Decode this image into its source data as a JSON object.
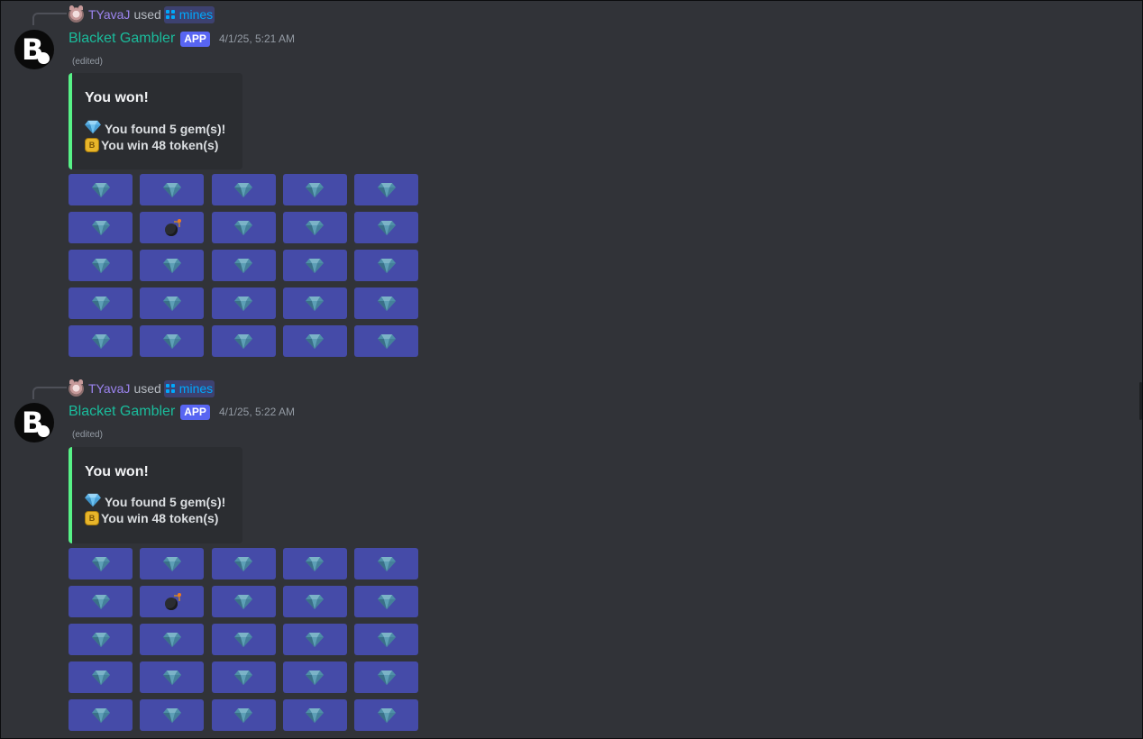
{
  "messages": [
    {
      "reply": {
        "user": "TYavaJ",
        "used": "used",
        "command": "mines"
      },
      "author": "Blacket Gambler",
      "badge": "APP",
      "timestamp": "4/1/25, 5:21 AM",
      "edited": "(edited)",
      "embed": {
        "title": "You won!",
        "line1": "You found 5 gem(s)!",
        "line2": "You win 48 token(s)",
        "accent": "#57f287"
      },
      "grid": [
        [
          "gem",
          "gem",
          "gem",
          "gem",
          "gem"
        ],
        [
          "gem",
          "bomb",
          "gem",
          "gem",
          "gem"
        ],
        [
          "gem",
          "gem",
          "gem",
          "gem",
          "gem"
        ],
        [
          "gem",
          "gem",
          "gem",
          "gem",
          "gem"
        ],
        [
          "gem",
          "gem",
          "gem",
          "gem",
          "gem"
        ]
      ]
    },
    {
      "reply": {
        "user": "TYavaJ",
        "used": "used",
        "command": "mines"
      },
      "author": "Blacket Gambler",
      "badge": "APP",
      "timestamp": "4/1/25, 5:22 AM",
      "edited": "(edited)",
      "embed": {
        "title": "You won!",
        "line1": "You found 5 gem(s)!",
        "line2": "You win 48 token(s)",
        "accent": "#57f287"
      },
      "grid": [
        [
          "gem",
          "gem",
          "gem",
          "gem",
          "gem"
        ],
        [
          "gem",
          "bomb",
          "gem",
          "gem",
          "gem"
        ],
        [
          "gem",
          "gem",
          "gem",
          "gem",
          "gem"
        ],
        [
          "gem",
          "gem",
          "gem",
          "gem",
          "gem"
        ],
        [
          "gem",
          "gem",
          "gem",
          "gem",
          "gem"
        ]
      ]
    }
  ],
  "colors": {
    "background": "#313338",
    "button": "#454ba8",
    "author": "#1abc9c",
    "reply_user": "#9c84ef",
    "command": "#00a8fc",
    "badge": "#5865f2"
  },
  "icons": {
    "gem": "gem-icon",
    "bomb": "bomb-icon",
    "token": "token-icon",
    "command": "command-icon"
  }
}
